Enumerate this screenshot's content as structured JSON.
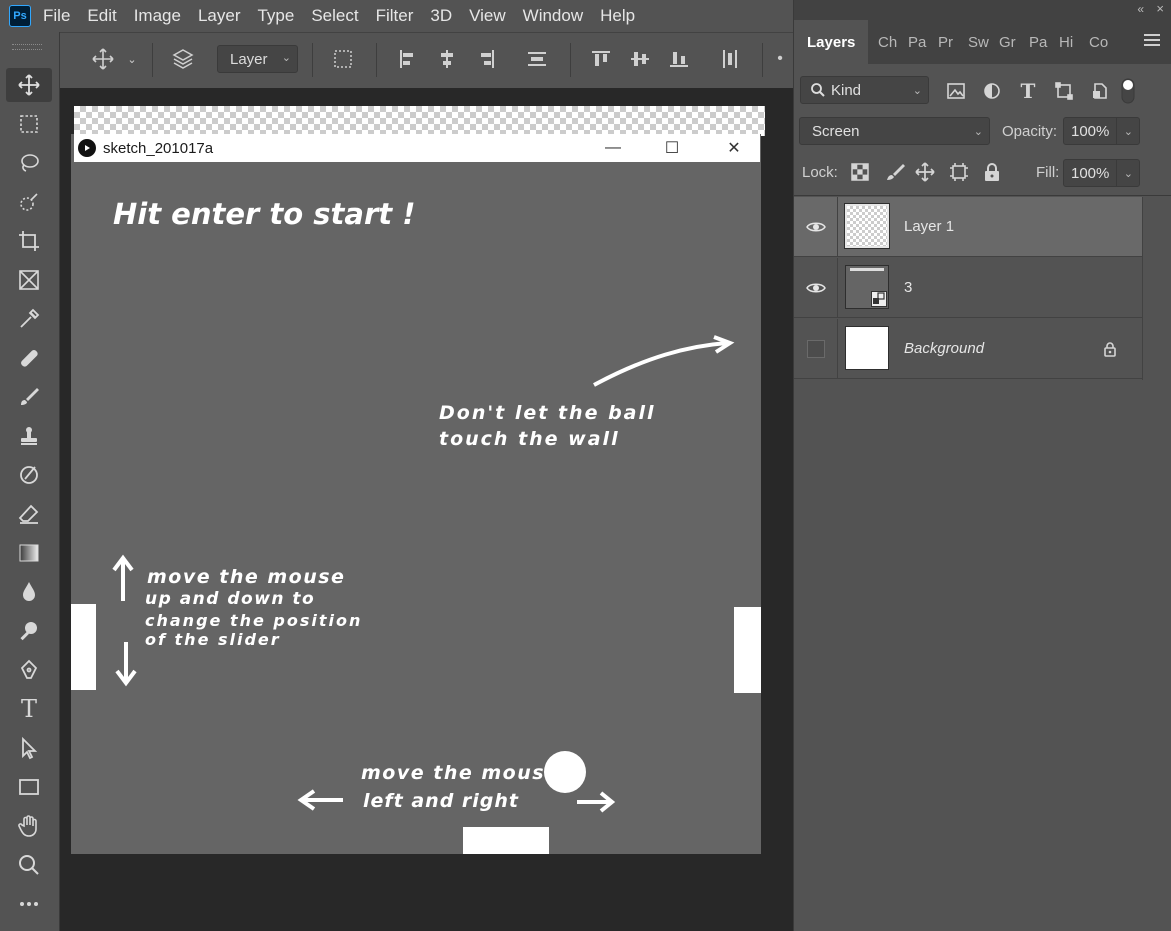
{
  "menu": [
    "File",
    "Edit",
    "Image",
    "Layer",
    "Type",
    "Select",
    "Filter",
    "3D",
    "View",
    "Window",
    "Help"
  ],
  "app_logo": "Ps",
  "options_bar": {
    "auto_select_target": "Layer"
  },
  "document": {
    "window_title": "sketch_201017a",
    "window_controls": [
      "minimize",
      "maximize",
      "close"
    ],
    "canvas_bg": "#656565",
    "annotations": {
      "start": "Hit enter to start !",
      "wall": "Don't let the ball touch the wall",
      "slider_line1": "move the mouse",
      "slider_line2": "up and down to",
      "slider_line3": "change the position",
      "slider_line4": "of the slider",
      "bottom_line1": "move the mous",
      "bottom_line2": "left and right"
    }
  },
  "panel": {
    "tabs": [
      "Layers",
      "Ch",
      "Pa",
      "Pr",
      "Sw",
      "Gr",
      "Pa",
      "Hi",
      "Co"
    ],
    "filter_kind": "Kind",
    "blend_mode": "Screen",
    "opacity_label": "Opacity:",
    "opacity_value": "100%",
    "lock_label": "Lock:",
    "fill_label": "Fill:",
    "fill_value": "100%",
    "layers": [
      {
        "name": "Layer 1",
        "visible": true,
        "selected": true
      },
      {
        "name": "3",
        "visible": true,
        "selected": false
      },
      {
        "name": "Background",
        "visible": false,
        "selected": false,
        "locked": true
      }
    ]
  },
  "colors": {
    "chrome": "#535353",
    "workspace": "#282828",
    "selected_layer": "#696969"
  }
}
